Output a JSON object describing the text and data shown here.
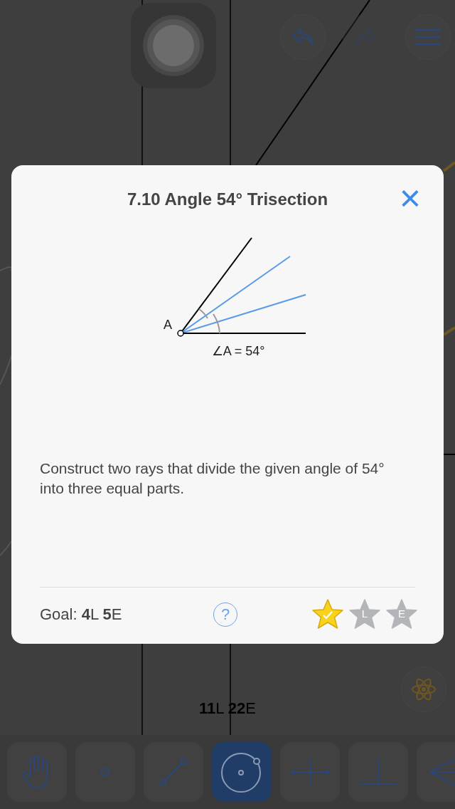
{
  "toolbar_top": {
    "undo": {
      "disabled": false
    },
    "redo": {
      "disabled": true
    }
  },
  "score": "**11**L  **22**E",
  "tools": [
    {
      "kind": "hand",
      "selected": false
    },
    {
      "kind": "point",
      "selected": false
    },
    {
      "kind": "segment",
      "selected": false
    },
    {
      "kind": "circle",
      "selected": true
    },
    {
      "kind": "bisector",
      "selected": false
    },
    {
      "kind": "perpendicular",
      "selected": false
    },
    {
      "kind": "angle",
      "selected": false
    }
  ],
  "dialog": {
    "title": "7.10 Angle 54° Trisection",
    "close": "×",
    "figure": {
      "vertex_label": "A",
      "caption": "∠A = 54°"
    },
    "description": "Construct two rays that divide the given angle of 54° into three equal parts.",
    "goal": "Goal: **4**L  **5**E",
    "help": "?",
    "stars": 1,
    "star_letters": [
      "L",
      "E"
    ]
  }
}
